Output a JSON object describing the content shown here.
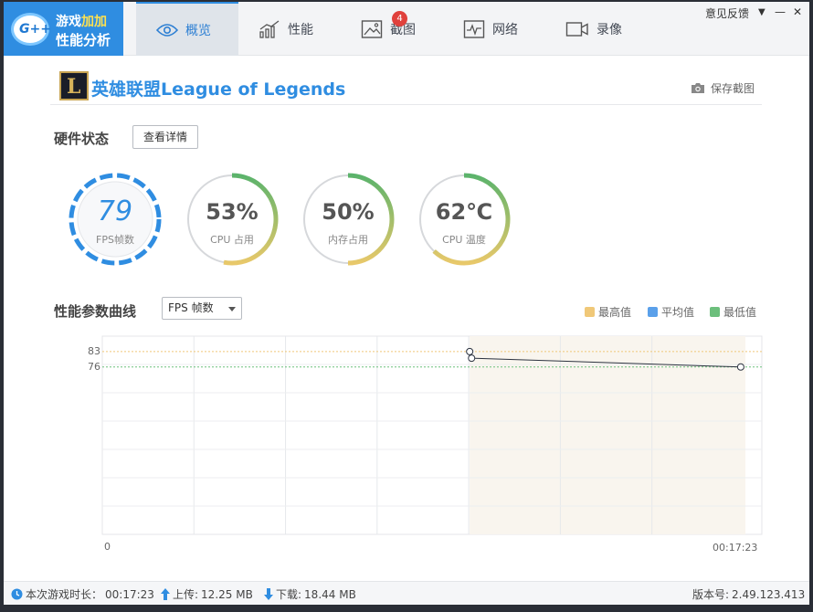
{
  "app": {
    "brand_line1_a": "游戏",
    "brand_line1_b": "加加",
    "brand_line2": "性能分析",
    "logo_text": "G++"
  },
  "tabs": [
    {
      "label": "概览",
      "icon": "eye-icon",
      "active": true
    },
    {
      "label": "性能",
      "icon": "performance-chart-icon"
    },
    {
      "label": "截图",
      "icon": "screenshot-image-icon",
      "badge": "4"
    },
    {
      "label": "网络",
      "icon": "network-pulse-icon"
    },
    {
      "label": "录像",
      "icon": "video-camera-icon"
    }
  ],
  "window": {
    "feedback": "意见反馈",
    "dropdown_glyph": "▼",
    "minimize_glyph": "—",
    "close_glyph": "✕"
  },
  "game": {
    "icon_letter": "L",
    "title": "英雄联盟League of Legends",
    "save_screenshot": "保存截图"
  },
  "hardware": {
    "title": "硬件状态",
    "detail_button": "查看详情",
    "gauges": [
      {
        "value": "79",
        "label": "FPS帧数",
        "fraction": 1.0,
        "style": "dashed-blue"
      },
      {
        "value": "53%",
        "label": "CPU 占用",
        "fraction": 0.53
      },
      {
        "value": "50%",
        "label": "内存占用",
        "fraction": 0.5
      },
      {
        "value": "62℃",
        "label": "CPU 温度",
        "fraction": 0.62
      }
    ]
  },
  "curve": {
    "title": "性能参数曲线",
    "select_value": "FPS 帧数",
    "legend": [
      {
        "label": "最高值",
        "color": "#f0c878"
      },
      {
        "label": "平均值",
        "color": "#5aa0ea"
      },
      {
        "label": "最低值",
        "color": "#6cbf7c"
      }
    ]
  },
  "chart_data": {
    "type": "line",
    "y_ticks": [
      "83",
      "76"
    ],
    "x_start_label": "0",
    "x_end_label": "00:17:23",
    "max_line": 83,
    "min_line": 76,
    "points": [
      {
        "x_frac": 0.571,
        "y": 83
      },
      {
        "x_frac": 0.574,
        "y": 80
      },
      {
        "x_frac": 1.0,
        "y": 76
      }
    ],
    "y_range": [
      0,
      90
    ],
    "grid": true
  },
  "status": {
    "duration_label": "本次游戏时长：",
    "duration": "00:17:23",
    "upload_label": "上传: ",
    "upload": "12.25 MB",
    "download_label": "下载: ",
    "download": "18.44 MB",
    "version_label": "版本号: ",
    "version": "2.49.123.413"
  },
  "colors": {
    "accent": "#2f8de1",
    "gauge_green": "#5bb36b",
    "gauge_yellow": "#e8c86a",
    "gauge_track": "#d6d8db"
  }
}
